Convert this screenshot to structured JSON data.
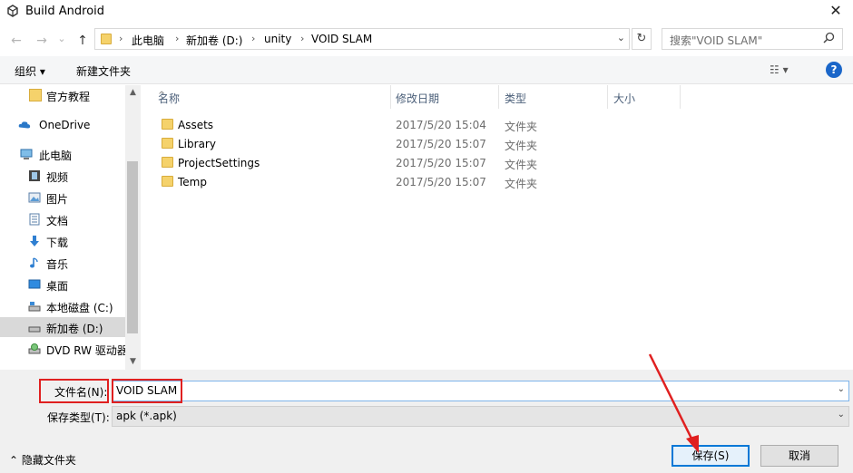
{
  "window": {
    "title": "Build Android",
    "close_glyph": "✕"
  },
  "nav": {
    "back": "←",
    "forward": "→",
    "recent": "⌄",
    "up": "↑"
  },
  "address": {
    "crumbs": [
      "此电脑",
      "新加卷 (D:)",
      "unity",
      "VOID SLAM"
    ],
    "separator": "›",
    "dropdown": "⌄",
    "refresh": "↻"
  },
  "search": {
    "placeholder": "搜索\"VOID SLAM\"",
    "icon": "search-icon"
  },
  "toolbar": {
    "organize": "组织 ▾",
    "new_folder": "新建文件夹",
    "view": "☷ ▾",
    "help": "?"
  },
  "sidebar": {
    "items": [
      {
        "label": "官方教程",
        "icon": "folder-icon"
      },
      {
        "label": "OneDrive",
        "icon": "cloud-icon"
      },
      {
        "label": "此电脑",
        "icon": "computer-icon"
      },
      {
        "label": "视频",
        "icon": "video-icon"
      },
      {
        "label": "图片",
        "icon": "picture-icon"
      },
      {
        "label": "文档",
        "icon": "document-icon"
      },
      {
        "label": "下载",
        "icon": "download-icon"
      },
      {
        "label": "音乐",
        "icon": "music-icon"
      },
      {
        "label": "桌面",
        "icon": "desktop-icon"
      },
      {
        "label": "本地磁盘 (C:)",
        "icon": "drive-icon"
      },
      {
        "label": "新加卷 (D:)",
        "icon": "drive-icon",
        "selected": true
      },
      {
        "label": "DVD RW 驱动器",
        "icon": "dvd-icon"
      }
    ],
    "scroll_up": "▲",
    "scroll_down": "▼"
  },
  "filelist": {
    "columns": [
      "名称",
      "修改日期",
      "类型",
      "大小"
    ],
    "sort_glyph": "^",
    "rows": [
      {
        "name": "Assets",
        "date": "2017/5/20 15:04",
        "type": "文件夹"
      },
      {
        "name": "Library",
        "date": "2017/5/20 15:07",
        "type": "文件夹"
      },
      {
        "name": "ProjectSettings",
        "date": "2017/5/20 15:07",
        "type": "文件夹"
      },
      {
        "name": "Temp",
        "date": "2017/5/20 15:07",
        "type": "文件夹"
      }
    ]
  },
  "form": {
    "filename_label": "文件名(N):",
    "filename_value": "VOID SLAM",
    "filetype_label": "保存类型(T):",
    "filetype_value": "apk (*.apk)",
    "dropdown": "⌄"
  },
  "footer": {
    "hide_folders": "⌃ 隐藏文件夹",
    "save": "保存(S)",
    "cancel": "取消"
  },
  "colors": {
    "accent": "#0078d7",
    "highlight_annotation": "#e02020",
    "folder": "#f5d26b"
  }
}
